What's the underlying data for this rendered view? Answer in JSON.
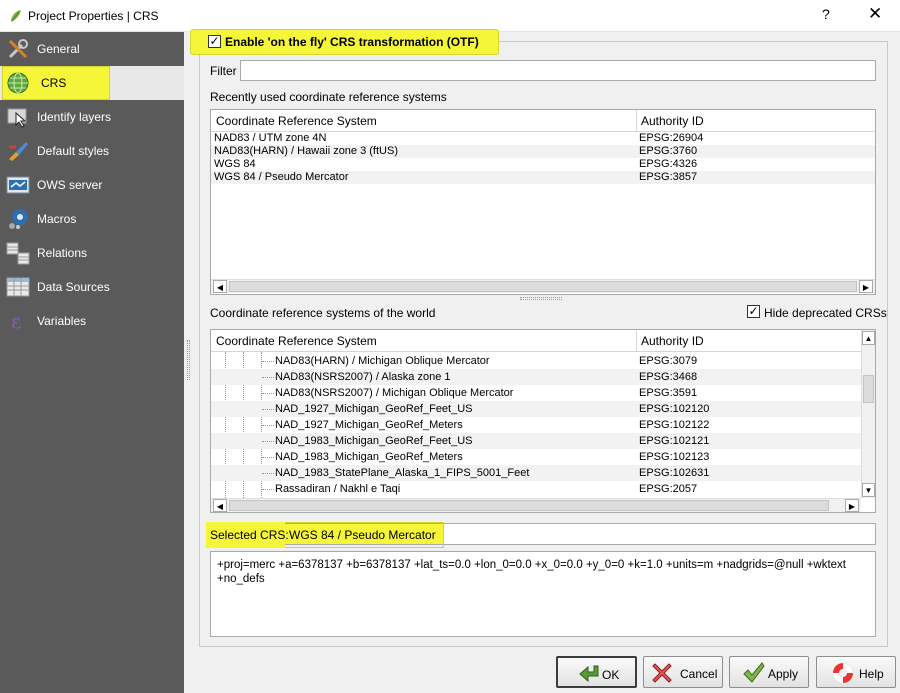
{
  "window": {
    "title": "Project Properties | CRS",
    "help_glyph": "?",
    "close_glyph": "✕"
  },
  "sidebar": {
    "items": [
      {
        "label": "General",
        "icon": "wrench-screwdriver-icon"
      },
      {
        "label": "CRS",
        "icon": "globe-icon"
      },
      {
        "label": "Identify layers",
        "icon": "identify-cursor-icon"
      },
      {
        "label": "Default styles",
        "icon": "paint-brush-icon"
      },
      {
        "label": "OWS server",
        "icon": "ows-server-icon"
      },
      {
        "label": "Macros",
        "icon": "macro-gear-icon"
      },
      {
        "label": "Relations",
        "icon": "relations-table-icon"
      },
      {
        "label": "Data Sources",
        "icon": "data-sources-table-icon"
      },
      {
        "label": "Variables",
        "icon": "variables-epsilon-icon"
      }
    ],
    "selected": "CRS"
  },
  "otf": {
    "label": "Enable 'on the fly' CRS transformation (OTF)",
    "checked": true,
    "check_glyph": "✓"
  },
  "filter": {
    "label": "Filter",
    "value": ""
  },
  "recent": {
    "label": "Recently used coordinate reference systems",
    "columns": [
      "Coordinate Reference System",
      "Authority ID"
    ],
    "rows": [
      {
        "crs": "NAD83 / UTM zone 4N",
        "id": "EPSG:26904"
      },
      {
        "crs": "NAD83(HARN) / Hawaii zone 3 (ftUS)",
        "id": "EPSG:3760"
      },
      {
        "crs": "WGS 84",
        "id": "EPSG:4326"
      },
      {
        "crs": "WGS 84 / Pseudo Mercator",
        "id": "EPSG:3857"
      }
    ]
  },
  "world": {
    "label": "Coordinate reference systems of the world",
    "hide_deprecated_label": "Hide deprecated CRSs",
    "hide_deprecated_checked": true,
    "check_glyph": "✓",
    "columns": [
      "Coordinate Reference System",
      "Authority ID"
    ],
    "rows": [
      {
        "crs": "NAD83(HARN) / Michigan Oblique Mercator",
        "id": "EPSG:3079"
      },
      {
        "crs": "NAD83(NSRS2007) / Alaska zone 1",
        "id": "EPSG:3468"
      },
      {
        "crs": "NAD83(NSRS2007) / Michigan Oblique Mercator",
        "id": "EPSG:3591"
      },
      {
        "crs": "NAD_1927_Michigan_GeoRef_Feet_US",
        "id": "EPSG:102120"
      },
      {
        "crs": "NAD_1927_Michigan_GeoRef_Meters",
        "id": "EPSG:102122"
      },
      {
        "crs": "NAD_1983_Michigan_GeoRef_Feet_US",
        "id": "EPSG:102121"
      },
      {
        "crs": "NAD_1983_Michigan_GeoRef_Meters",
        "id": "EPSG:102123"
      },
      {
        "crs": "NAD_1983_StatePlane_Alaska_1_FIPS_5001_Feet",
        "id": "EPSG:102631"
      },
      {
        "crs": "Rassadiran / Nakhl e Taqi",
        "id": "EPSG:2057"
      }
    ]
  },
  "selected_crs": {
    "label": "Selected CRS:",
    "value": "WGS 84 / Pseudo Mercator"
  },
  "proj_string": "+proj=merc +a=6378137 +b=6378137 +lat_ts=0.0 +lon_0=0.0 +x_0=0.0 +y_0=0 +k=1.0 +units=m +nadgrids=@null +wktext +no_defs",
  "buttons": {
    "ok": "OK",
    "cancel": "Cancel",
    "apply": "Apply",
    "help": "Help"
  },
  "colors": {
    "highlight": "#f5f53a",
    "sidebar_bg": "#5a5a5a"
  }
}
